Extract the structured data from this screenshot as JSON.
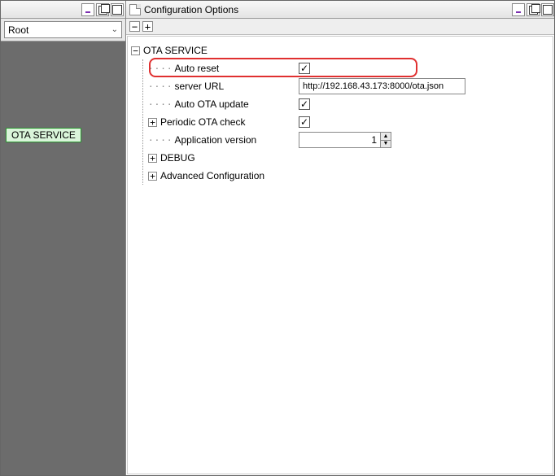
{
  "leftPanel": {
    "comboValue": "Root",
    "serviceTag": "OTA SERVICE"
  },
  "rightPanel": {
    "title": "Configuration Options",
    "toolbar": {
      "collapse": "−",
      "expand": "+"
    },
    "tree": {
      "root": {
        "label": "OTA SERVICE",
        "items": {
          "autoReset": {
            "label": "Auto reset",
            "checked": true
          },
          "serverUrl": {
            "label": "server URL",
            "value": "http://192.168.43.173:8000/ota.json"
          },
          "autoOta": {
            "label": "Auto OTA update",
            "checked": true
          },
          "periodic": {
            "label": "Periodic OTA check",
            "checked": true
          },
          "appVersion": {
            "label": "Application version",
            "value": "1"
          },
          "debug": {
            "label": "DEBUG"
          },
          "advanced": {
            "label": "Advanced Configuration"
          }
        }
      }
    }
  },
  "glyphs": {
    "minus": "−",
    "plus": "+",
    "dots": "····",
    "chev": "⌄",
    "up": "▲",
    "down": "▼"
  }
}
